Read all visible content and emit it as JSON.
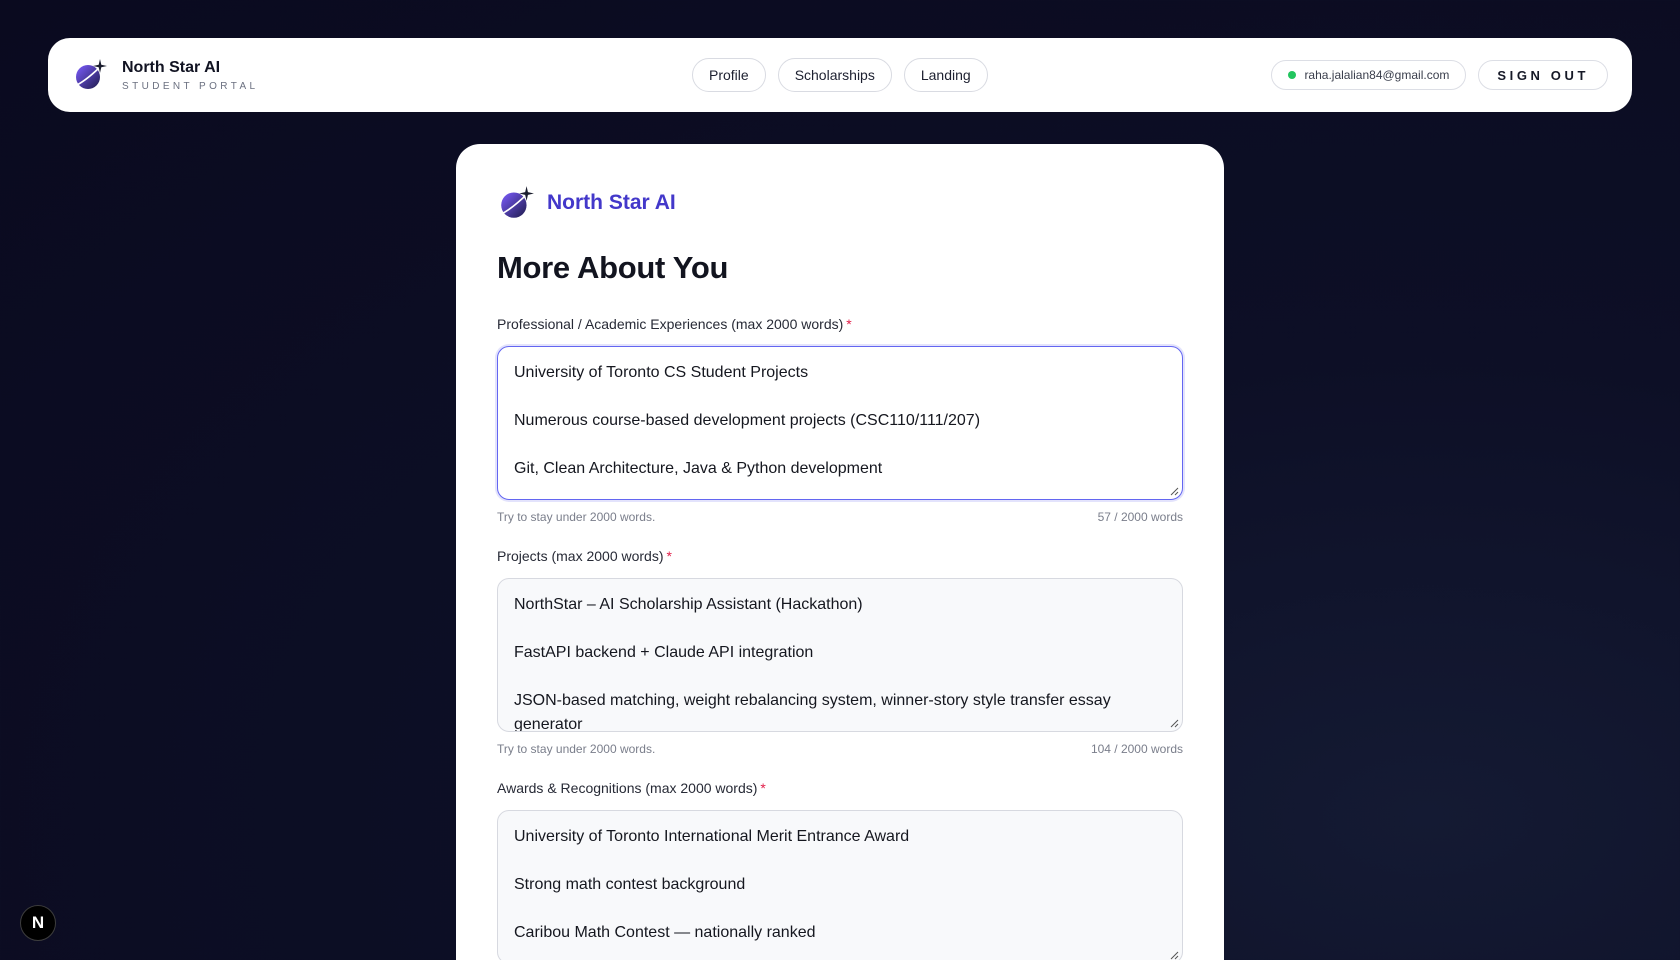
{
  "header": {
    "brand_name": "North Star AI",
    "brand_subtitle": "STUDENT PORTAL",
    "nav": [
      "Profile",
      "Scholarships",
      "Landing"
    ],
    "user_email": "raha.jalalian84@gmail.com",
    "sign_out_label": "SIGN OUT"
  },
  "card": {
    "brand_name": "North Star AI",
    "title": "More About You",
    "fields": [
      {
        "label": "Professional / Academic Experiences (max 2000 words)",
        "required_mark": "*",
        "lines": [
          "University of Toronto CS Student Projects",
          "Numerous course-based development projects (CSC110/111/207)",
          "Git, Clean Architecture, Java & Python development"
        ],
        "hint": "Try to stay under 2000 words.",
        "word_count": "57 / 2000 words",
        "focused": true
      },
      {
        "label": "Projects (max 2000 words)",
        "required_mark": "*",
        "lines": [
          "NorthStar – AI Scholarship Assistant (Hackathon)",
          "FastAPI backend + Claude API integration",
          "JSON-based matching, weight rebalancing system, winner-story style transfer essay generator"
        ],
        "hint": "Try to stay under 2000 words.",
        "word_count": "104 / 2000 words",
        "focused": false
      },
      {
        "label": "Awards & Recognitions (max 2000 words)",
        "required_mark": "*",
        "lines": [
          "University of Toronto International Merit Entrance Award",
          "Strong math contest background",
          "Caribou Math Contest — nationally ranked"
        ],
        "focused": false
      }
    ]
  },
  "dev_badge": "N",
  "colors": {
    "accent": "#4338ca",
    "focus_ring": "#6366f1",
    "required": "#e11d48",
    "status_online": "#22c55e"
  }
}
